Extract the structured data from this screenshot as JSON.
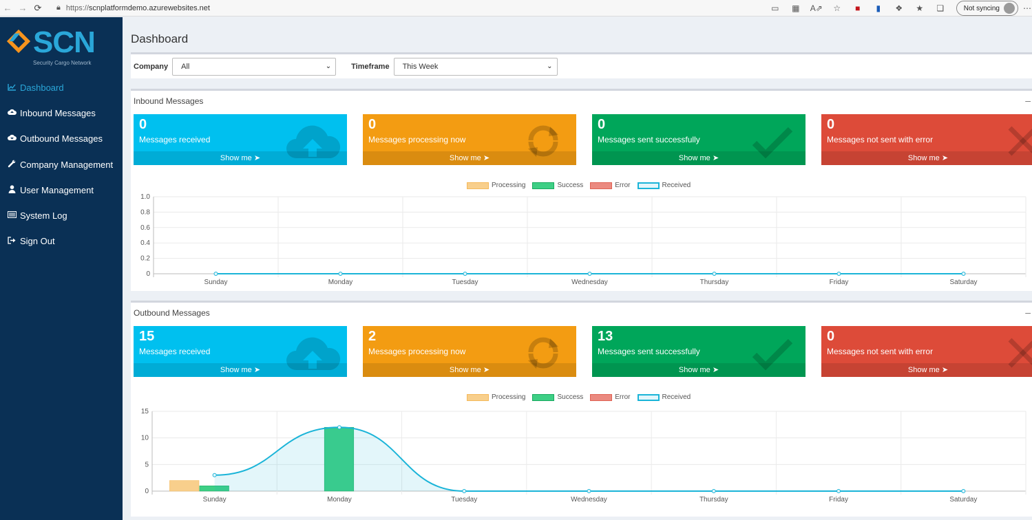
{
  "browser": {
    "url_prefix": "https://",
    "url_host": "scnplatformdemo.azurewebsites.net",
    "sync_label": "Not syncing"
  },
  "logo": {
    "text": "SCN",
    "subtitle": "Security Cargo Network"
  },
  "sidebar": {
    "items": [
      {
        "label": "Dashboard",
        "icon": "chart-line-icon",
        "active": true
      },
      {
        "label": "Inbound Messages",
        "icon": "cloud-upload-icon"
      },
      {
        "label": "Outbound Messages",
        "icon": "cloud-download-icon"
      },
      {
        "label": "Company Management",
        "icon": "wrench-icon"
      },
      {
        "label": "User Management",
        "icon": "user-icon"
      },
      {
        "label": "System Log",
        "icon": "list-icon"
      },
      {
        "label": "Sign Out",
        "icon": "sign-out-icon"
      }
    ]
  },
  "page": {
    "title": "Dashboard"
  },
  "filters": {
    "company_label": "Company",
    "company_value": "All",
    "timeframe_label": "Timeframe",
    "timeframe_value": "This Week"
  },
  "show_me": "Show me",
  "legend": {
    "processing": "Processing",
    "success": "Success",
    "error": "Error",
    "received": "Received"
  },
  "colors": {
    "aqua": "#00c0ef",
    "yellow": "#f39c12",
    "green": "#00a65a",
    "red": "#dd4b39",
    "sidebar": "#0a3055",
    "accent": "#2aa7d9"
  },
  "inbound": {
    "title": "Inbound Messages",
    "tiles": [
      {
        "value": "0",
        "label": "Messages received"
      },
      {
        "value": "0",
        "label": "Messages processing now"
      },
      {
        "value": "0",
        "label": "Messages sent successfully"
      },
      {
        "value": "0",
        "label": "Messages not sent with error"
      }
    ]
  },
  "outbound": {
    "title": "Outbound Messages",
    "tiles": [
      {
        "value": "15",
        "label": "Messages received"
      },
      {
        "value": "2",
        "label": "Messages processing now"
      },
      {
        "value": "13",
        "label": "Messages sent successfully"
      },
      {
        "value": "0",
        "label": "Messages not sent with error"
      }
    ]
  },
  "chart_data": [
    {
      "type": "bar",
      "categories": [
        "Sunday",
        "Monday",
        "Tuesday",
        "Wednesday",
        "Thursday",
        "Friday",
        "Saturday"
      ],
      "ylim": [
        0,
        1
      ],
      "yticks": [
        "0",
        "0.2",
        "0.4",
        "0.6",
        "0.8",
        "1.0"
      ],
      "series": [
        {
          "name": "Processing",
          "values": [
            0,
            0,
            0,
            0,
            0,
            0,
            0
          ]
        },
        {
          "name": "Success",
          "values": [
            0,
            0,
            0,
            0,
            0,
            0,
            0
          ]
        },
        {
          "name": "Error",
          "values": [
            0,
            0,
            0,
            0,
            0,
            0,
            0
          ]
        },
        {
          "name": "Received",
          "type": "area",
          "values": [
            0,
            0,
            0,
            0,
            0,
            0,
            0
          ]
        }
      ]
    },
    {
      "type": "bar",
      "categories": [
        "Sunday",
        "Monday",
        "Tuesday",
        "Wednesday",
        "Thursday",
        "Friday",
        "Saturday"
      ],
      "ylim": [
        0,
        15
      ],
      "yticks": [
        "0",
        "5",
        "10",
        "15"
      ],
      "series": [
        {
          "name": "Processing",
          "values": [
            2,
            0,
            0,
            0,
            0,
            0,
            0
          ]
        },
        {
          "name": "Success",
          "values": [
            1,
            12,
            0,
            0,
            0,
            0,
            0
          ]
        },
        {
          "name": "Error",
          "values": [
            0,
            0,
            0,
            0,
            0,
            0,
            0
          ]
        },
        {
          "name": "Received",
          "type": "area",
          "values": [
            3,
            12,
            0,
            0,
            0,
            0,
            0
          ]
        }
      ]
    }
  ]
}
